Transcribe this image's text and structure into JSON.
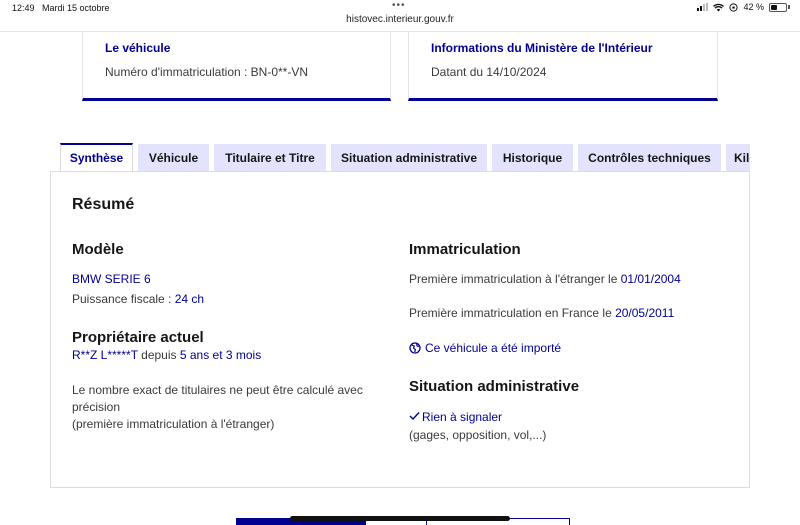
{
  "status_bar": {
    "time": "12:49",
    "date": "Mardi 15 octobre",
    "battery": "42 %"
  },
  "browser": {
    "url": "histovec.interieur.gouv.fr"
  },
  "cards": [
    {
      "title": "Le véhicule",
      "text": "Numéro d'immatriculation : BN-0**-VN"
    },
    {
      "title": "Informations du Ministère de l'Intérieur",
      "text": "Datant du 14/10/2024"
    }
  ],
  "tabs": [
    {
      "label": "Synthèse",
      "active": true
    },
    {
      "label": "Véhicule",
      "active": false
    },
    {
      "label": "Titulaire et Titre",
      "active": false
    },
    {
      "label": "Situation administrative",
      "active": false
    },
    {
      "label": "Historique",
      "active": false
    },
    {
      "label": "Contrôles techniques",
      "active": false
    },
    {
      "label": "Kilométrage",
      "active": false
    }
  ],
  "resume": {
    "title": "Résumé",
    "modele": {
      "heading": "Modèle",
      "name": "BMW SERIE 6",
      "puissance_label": "Puissance fiscale : ",
      "puissance_value": "24 ch"
    },
    "proprietaire": {
      "heading": "Propriétaire actuel",
      "name": "R**Z L*****T",
      "depuis": " depuis ",
      "duration": "5 ans et 3 mois",
      "note_line1": "Le nombre exact de titulaires ne peut être calculé avec",
      "note_line2": "précision",
      "note_line3": "(première immatriculation à l'étranger)"
    },
    "immatriculation": {
      "heading": "Immatriculation",
      "etranger_label": "Première immatriculation à l'étranger le ",
      "etranger_date": "01/01/2004",
      "france_label": "Première immatriculation en France le ",
      "france_date": "20/05/2011",
      "import_link": "Ce véhicule a été importé"
    },
    "situation": {
      "heading": "Situation administrative",
      "status": "Rien à signaler",
      "detail": "(gages, opposition, vol,...)"
    }
  },
  "colors": {
    "primary": "#000091",
    "tab_bg": "#e3e3fd",
    "text": "#3a3a3a",
    "heading": "#161616"
  }
}
